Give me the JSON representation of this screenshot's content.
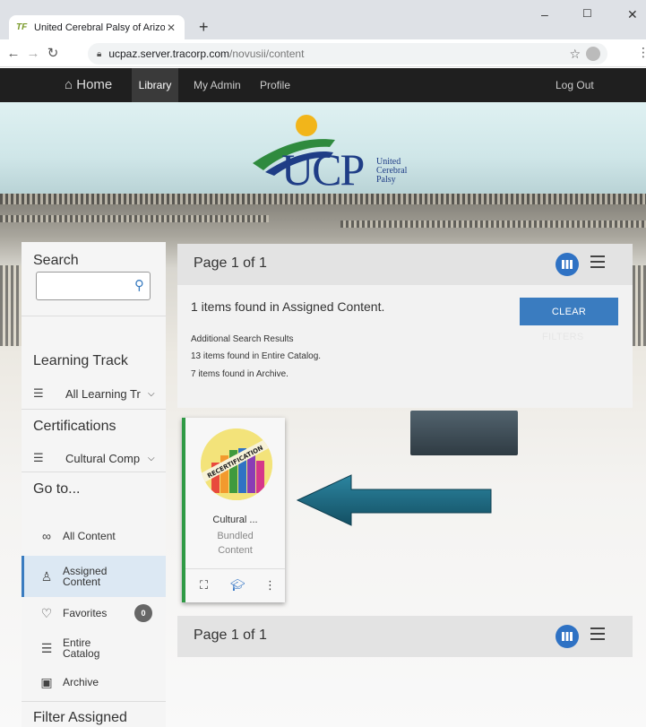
{
  "browser": {
    "tab_title": "United Cerebral Palsy of Arizona",
    "tab_favicon": "TF",
    "url_host": "ucpaz.server.tracorp.com",
    "url_path": "/novusii/content"
  },
  "nav": {
    "home": "Home",
    "library": "Library",
    "my_admin": "My Admin",
    "profile": "Profile",
    "logout": "Log Out"
  },
  "banner": {
    "logo_text": "UCP",
    "logo_sub": [
      "United",
      "Cerebral",
      "Palsy"
    ]
  },
  "sidebar": {
    "search_heading": "Search",
    "search_value": "",
    "learning_track_heading": "Learning Track",
    "learning_track_value": "All Learning Tr",
    "certifications_heading": "Certifications",
    "certifications_value": "Cultural Comp",
    "goto_heading": "Go to...",
    "items": [
      {
        "label": "All Content",
        "icon": "infinity-icon"
      },
      {
        "label": "Assigned Content",
        "icon": "user-icon"
      },
      {
        "label": "Favorites",
        "icon": "heart-icon",
        "badge": "0"
      },
      {
        "label": "Entire Catalog",
        "icon": "list-icon"
      },
      {
        "label": "Archive",
        "icon": "archive-icon"
      }
    ],
    "filter_heading": "Filter Assigned"
  },
  "main": {
    "page_label_top": "Page 1 of 1",
    "page_label_bottom": "Page 1 of 1",
    "found_text": "1 items found in Assigned Content.",
    "clear_button": "CLEAR",
    "clear_overflow": "FILTERS",
    "additional_title": "Additional Search Results",
    "additional_catalog": "13 items found in Entire Catalog.",
    "additional_archive": "7 items found in Archive."
  },
  "card": {
    "title": "Cultural ...",
    "type_line1": "Bundled",
    "type_line2": "Content",
    "thumb_text": "RECERTIFICATION",
    "accent_color": "#2f9a45"
  },
  "colors": {
    "primary": "#2f72c4",
    "nav_bg": "#1f1f1f",
    "arrow": "#1f6d84"
  }
}
